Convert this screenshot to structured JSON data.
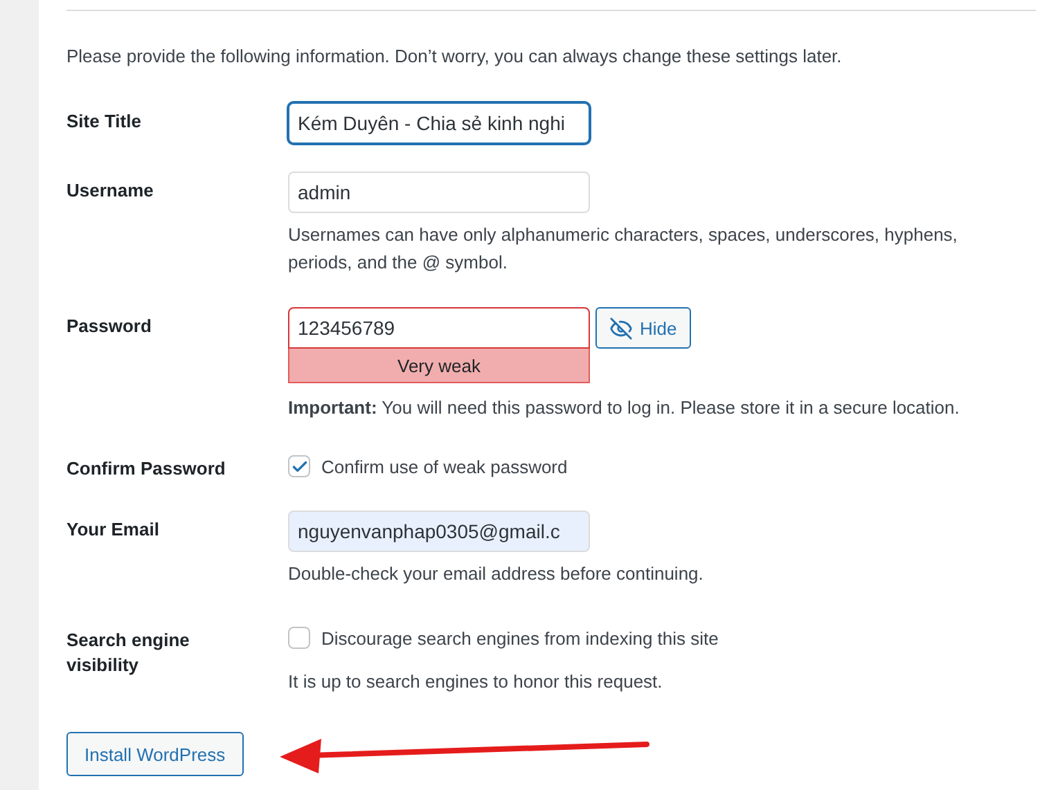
{
  "intro": "Please provide the following information. Don’t worry, you can always change these settings later.",
  "fields": [
    {
      "kind": "text",
      "label": "Site Title",
      "value": "Kém Duyên - Chia sẻ kinh nghi",
      "focused": true
    },
    {
      "kind": "text",
      "label": "Username",
      "value": "admin",
      "focused": false,
      "hint": "Usernames can have only alphanumeric characters, spaces, underscores, hyphens, periods, and the @ symbol."
    },
    {
      "kind": "password",
      "label": "Password",
      "value": "123456789",
      "strength": "Very weak",
      "toggle": "Hide",
      "hint": "**Important:** You will need this password to log in. Please store it in a secure location."
    },
    {
      "kind": "checkbox",
      "label": "Confirm Password",
      "option": "Confirm use of weak password",
      "checked": true
    },
    {
      "kind": "email",
      "label": "Your Email",
      "value": "nguyenvanphap0305@gmail.c",
      "focused": false,
      "hint": "Double-check your email address before continuing."
    },
    {
      "kind": "checkbox",
      "label": "Search engine visibility",
      "option": "Discourage search engines from indexing this site",
      "checked": false,
      "hint": "It is up to search engines to honor this request."
    }
  ],
  "submit": "Install WordPress"
}
